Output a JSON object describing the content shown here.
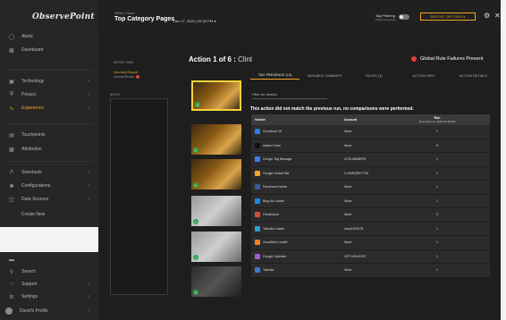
{
  "brand": {
    "logo": "ObservePoint"
  },
  "sidebar": {
    "items": [
      {
        "label": "Alerts",
        "icon": "bell-icon"
      },
      {
        "label": "Dashboard",
        "icon": "grid-icon"
      },
      {
        "label": "Technology",
        "icon": "layers-icon"
      },
      {
        "label": "Privacy",
        "icon": "shield-icon"
      },
      {
        "label": "Experience",
        "icon": "chart-line-icon"
      },
      {
        "label": "Touchpoints",
        "icon": "touchpoints-icon"
      },
      {
        "label": "Attribution",
        "icon": "attribution-icon"
      },
      {
        "label": "Standards",
        "icon": "standards-icon"
      },
      {
        "label": "Configurations",
        "icon": "wrench-icon"
      },
      {
        "label": "Data Sources",
        "icon": "database-icon"
      },
      {
        "label": "Create New",
        "icon": ""
      },
      {
        "label": "Search",
        "icon": "search-icon"
      },
      {
        "label": "Support",
        "icon": "help-icon"
      },
      {
        "label": "Settings",
        "icon": "gear-icon"
      },
      {
        "label": "David's Profile",
        "icon": "avatar-icon"
      }
    ]
  },
  "header": {
    "breadcrumb": "DEMO / Name",
    "title": "Top Category Pages",
    "run_date": "Dec 17, 2020 | 02:32 PM",
    "tag_filtering_label": "Tag Filtering",
    "tag_filtering_sub": "Filtering tag data",
    "report_options": "REPORT OPTIONS"
  },
  "left_panel": {
    "label": "REPORT VIEW",
    "journey_report": "Journey Report",
    "journey_sub": "Journey Results",
    "notes_label": "NOTES"
  },
  "action": {
    "title": "Action 1 of 6 : ",
    "name": "Clint",
    "failures": "Global Rule Failures Present"
  },
  "tabs": [
    "TAG PRESENCE (13)",
    "VARIABLE SUMMARY",
    "RULES (3)",
    "ACTION INFO",
    "ACTION DETAILS"
  ],
  "filter": {
    "placeholder": "Filter by Vendor"
  },
  "message": "This action did not match the previous run, no comparisons were performed.",
  "table": {
    "headers": {
      "vendor": "Vendor",
      "account": "Account",
      "run": "Run",
      "run_sub": "December 17, 2020 02:39 PM"
    },
    "rows": [
      {
        "vendor": "Cloudfront JS",
        "account": "None",
        "count": "1",
        "color": "#2a7de1"
      },
      {
        "vendor": "Adobe Fonts",
        "account": "None",
        "count": "6",
        "color": "#111111"
      },
      {
        "vendor": "Google Tag Manager",
        "account": "GTM-WBMKPK",
        "count": "1",
        "color": "#3b7ded"
      },
      {
        "vendor": "Google Global Site",
        "account": "G-HNPQRKT7NJ",
        "count": "1",
        "color": "#f4a623"
      },
      {
        "vendor": "Facebook Events",
        "account": "None",
        "count": "1",
        "color": "#3b5998"
      },
      {
        "vendor": "Bing Ad Loader",
        "account": "None",
        "count": "1",
        "color": "#1e88e5"
      },
      {
        "vendor": "Omnihouse",
        "account": "None",
        "count": "3",
        "color": "#d84a3a"
      },
      {
        "vendor": "Taboola Loader",
        "account": "cwsy1123478",
        "count": "1",
        "color": "#2aa0d8"
      },
      {
        "vendor": "Cloudflare Loader",
        "account": "None",
        "count": "1",
        "color": "#f38020"
      },
      {
        "vendor": "Google Optimize",
        "account": "OPT-NDNKH37",
        "count": "1",
        "color": "#9c5cd4"
      },
      {
        "vendor": "Taboola",
        "account": "None",
        "count": "1",
        "color": "#3a7bd5"
      }
    ]
  }
}
